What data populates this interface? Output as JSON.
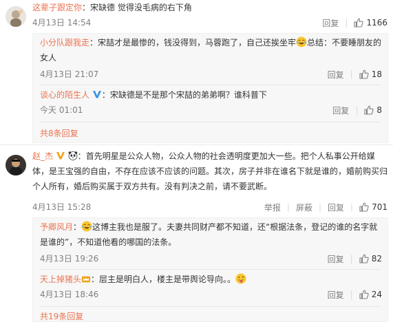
{
  "comments": [
    {
      "username": "这辈子跟定你",
      "colon": "：",
      "text": "宋缺德 觉得没毛病的右下角",
      "time": "4月13日 14:54",
      "reply_label": "回复",
      "like_count": "1166",
      "replies": [
        {
          "username": "小分队跟我走",
          "colon": "：",
          "text_a": "宋喆才是最惨的，钱没得到，马蓉跑了，自己还挨坐牢",
          "text_b": "总结：不要睡朋友的女人",
          "time": "4月13日 21:07",
          "like_count": "18"
        },
        {
          "username": "谈心的陌生人",
          "colon": "：",
          "text": "宋缺德是不是那个宋喆的弟弟啊？谁科普下",
          "time": "今天 01:01",
          "like_count": "8"
        }
      ],
      "more_replies": "共8条回复"
    },
    {
      "username": "赵_杰",
      "colon": "：",
      "text": "首先明星是公众人物，公众人物的社会透明度更加大一些。把个人私事公开给媒体，是王宝强的自由，不存在应该不应该的问题。其次，房子并非在谁名下就是谁的，婚前购买归个人所有，婚后购买属于双方共有。没有判决之前，请不要武断。",
      "time": "4月13日 15:28",
      "report_label": "举报",
      "block_label": "屏蔽",
      "reply_label": "回复",
      "like_count": "701",
      "replies": [
        {
          "username": "予卿风月",
          "colon": "：",
          "text": "这博主我也是服了。夫妻共同财产都不知道，还“根据法条，登记的谁的名字就是谁的”，不知道他看的哪国的法条。",
          "time": "4月13日 19:26",
          "like_count": "82"
        },
        {
          "username": "天上掉猪头",
          "colon": "：",
          "text": "层主是明白人，楼主是带舆论导向。。",
          "time": "4月13日 18:46",
          "like_count": "24"
        }
      ],
      "more_replies": "共19条回复"
    }
  ],
  "reply_label": "回复",
  "colors": {
    "link": "#eb7350",
    "meta": "#808080",
    "bg_reply": "#f7f7f7",
    "verified": "#3b91e0"
  }
}
